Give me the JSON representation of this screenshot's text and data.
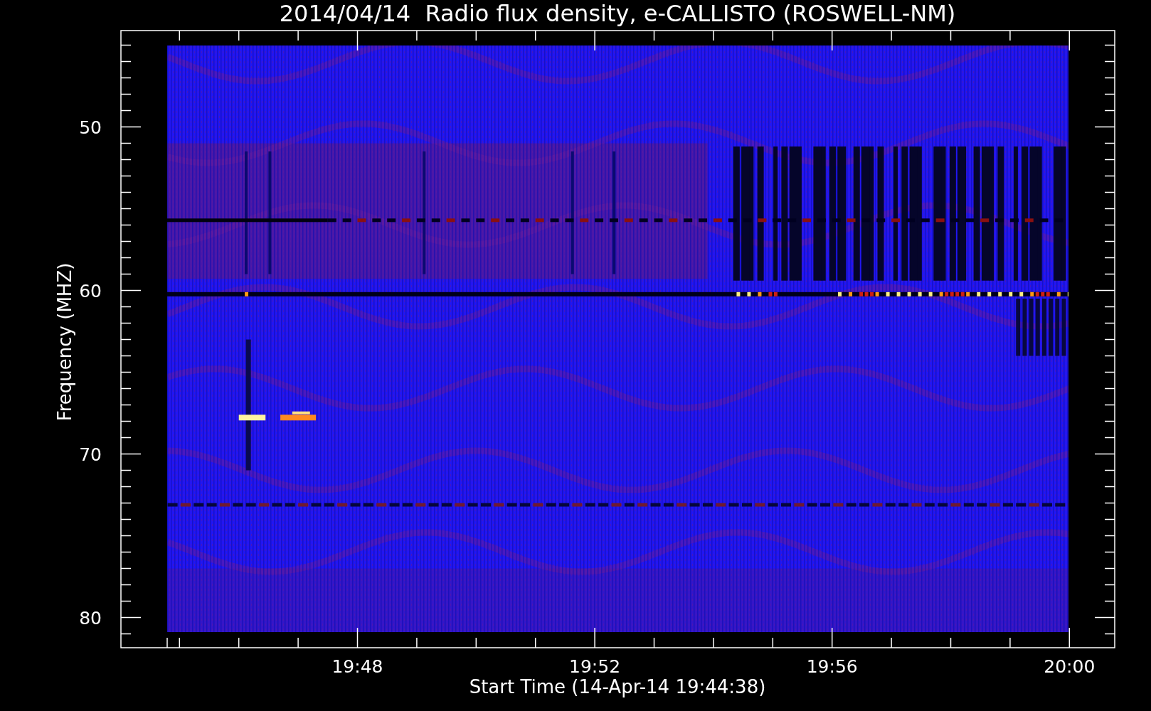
{
  "title": "2014/04/14  Radio flux density, e-CALLISTO (ROSWELL-NM)",
  "y_axis": {
    "label": "Frequency (MHZ)",
    "ticks": [
      "50",
      "60",
      "70",
      "80"
    ]
  },
  "x_axis": {
    "label": "Start Time (14-Apr-14 19:44:38)",
    "ticks": [
      "19:48",
      "19:52",
      "19:56",
      "20:00"
    ]
  }
}
